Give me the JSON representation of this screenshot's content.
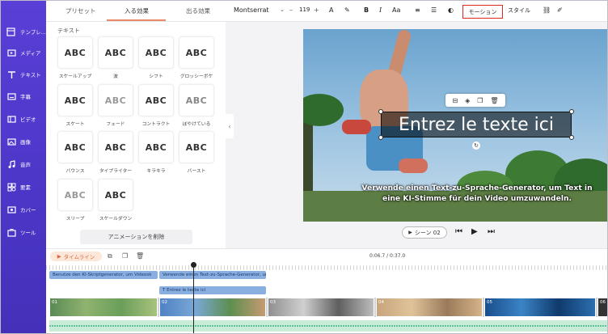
{
  "panel": {
    "tabs": [
      "プリセット",
      "入る効果",
      "出る効果"
    ],
    "section_title": "テキスト",
    "effects": [
      {
        "label": "スケールアップ",
        "preview": "ABC"
      },
      {
        "label": "波",
        "preview": "ABC"
      },
      {
        "label": "シフト",
        "preview": "ABC"
      },
      {
        "label": "グロッシーボケ",
        "preview": "ABC"
      },
      {
        "label": "スケート",
        "preview": "ABC"
      },
      {
        "label": "フェード",
        "preview": "ABC"
      },
      {
        "label": "コントラクト",
        "preview": "ABC"
      },
      {
        "label": "ぼやけている",
        "preview": "ABC"
      },
      {
        "label": "バウンス",
        "preview": "ABC"
      },
      {
        "label": "タイプライター",
        "preview": "ABC"
      },
      {
        "label": "キラキラ",
        "preview": "ABC"
      },
      {
        "label": "バースト",
        "preview": "ABC"
      },
      {
        "label": "スリープ",
        "preview": "ABC"
      },
      {
        "label": "スケールダウン",
        "preview": "ABC"
      }
    ],
    "remove_label": "アニメーションを削除"
  },
  "sidebar": {
    "items": [
      {
        "label": "テンプレ...",
        "icon": "template-icon"
      },
      {
        "label": "メディア",
        "icon": "media-icon"
      },
      {
        "label": "テキスト",
        "icon": "text-icon"
      },
      {
        "label": "字幕",
        "icon": "subtitle-icon"
      },
      {
        "label": "ビデオ",
        "icon": "video-icon"
      },
      {
        "label": "画像",
        "icon": "image-icon"
      },
      {
        "label": "音声",
        "icon": "audio-icon"
      },
      {
        "label": "要素",
        "icon": "elements-icon"
      },
      {
        "label": "カバー",
        "icon": "cover-icon"
      },
      {
        "label": "ツール",
        "icon": "tools-icon"
      }
    ]
  },
  "toolbar": {
    "font": "Montserrat",
    "font_size": "119",
    "motion_label": "モーション",
    "style_label": "スタイル"
  },
  "canvas": {
    "headline": "Entrez le texte ici",
    "subtitle": "Verwende einen Text-zu-Sprache-Generator, um Text in eine KI-Stimme für dein Video umzuwandeln."
  },
  "playback": {
    "scene_label": "シーン 02"
  },
  "timeline": {
    "label": "タイムライン",
    "time": "0:06.7 / 0:37.0",
    "subtitle_clip_1": "Benutze den KI-Skriptgenerator, um Videosk",
    "subtitle_clip_2": "Verwende einen Text-zu-Sprache-Generator, um Text",
    "text_clip": "Entrez le texte ici",
    "scene_numbers": [
      "01",
      "02",
      "03",
      "04",
      "05",
      "06"
    ]
  },
  "colors": {
    "nav": "#4b36c7",
    "accent": "#e88a66",
    "highlight_border": "#e0281b"
  }
}
